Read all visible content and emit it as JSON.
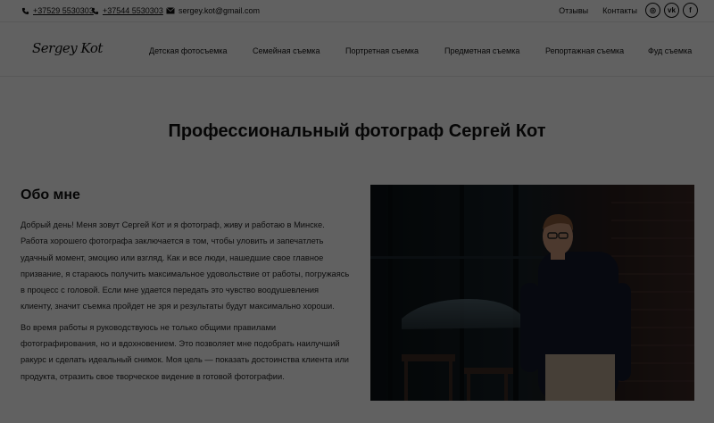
{
  "topbar": {
    "phone1": "+37529 5530303",
    "phone2": "+37544 5530303",
    "email": "sergey.kot@gmail.com",
    "links": [
      "Отзывы",
      "Контакты"
    ],
    "social": [
      {
        "icon": "instagram-icon",
        "glyph": "◎"
      },
      {
        "icon": "vk-icon",
        "glyph": "vk"
      },
      {
        "icon": "facebook-icon",
        "glyph": "f"
      }
    ]
  },
  "header": {
    "logo": "Sergey Kot",
    "nav": [
      "Детская фотосъемка",
      "Семейная съемка",
      "Портретная съемка",
      "Предметная съемка",
      "Репортажная съемка",
      "Фуд съемка"
    ]
  },
  "main": {
    "title": "Профессиональный фотограф Сергей Кот",
    "about_heading": "Обо мне",
    "paragraph1": "Добрый день! Меня зовут Сергей Кот и я фотограф, живу и работаю в Минске. Работа хорошего фотографа заключается в том, чтобы уловить и запечатлеть удачный момент, эмоцию или взгляд. Как и все люди, нашедшие свое главное призвание, я стараюсь получить максимальное удовольствие от работы, погружаясь в процесс с головой. Если мне удается передать это чувство воодушевления клиенту, значит съемка пройдет не зря и результаты будут максимально хороши.",
    "paragraph2": "Во время работы я руководствуюсь не только общими правилами фотографирования, но и вдохновением. Это позволяет мне подобрать наилучший ракурс и сделать идеальный снимок. Моя цель — показать достоинства клиента или продукта, отразить свое творческое видение в готовой фотографии."
  },
  "colors": {
    "overlay": "rgba(0,0,0,0.62)",
    "text": "#111111",
    "page_bg": "#ffffff"
  }
}
